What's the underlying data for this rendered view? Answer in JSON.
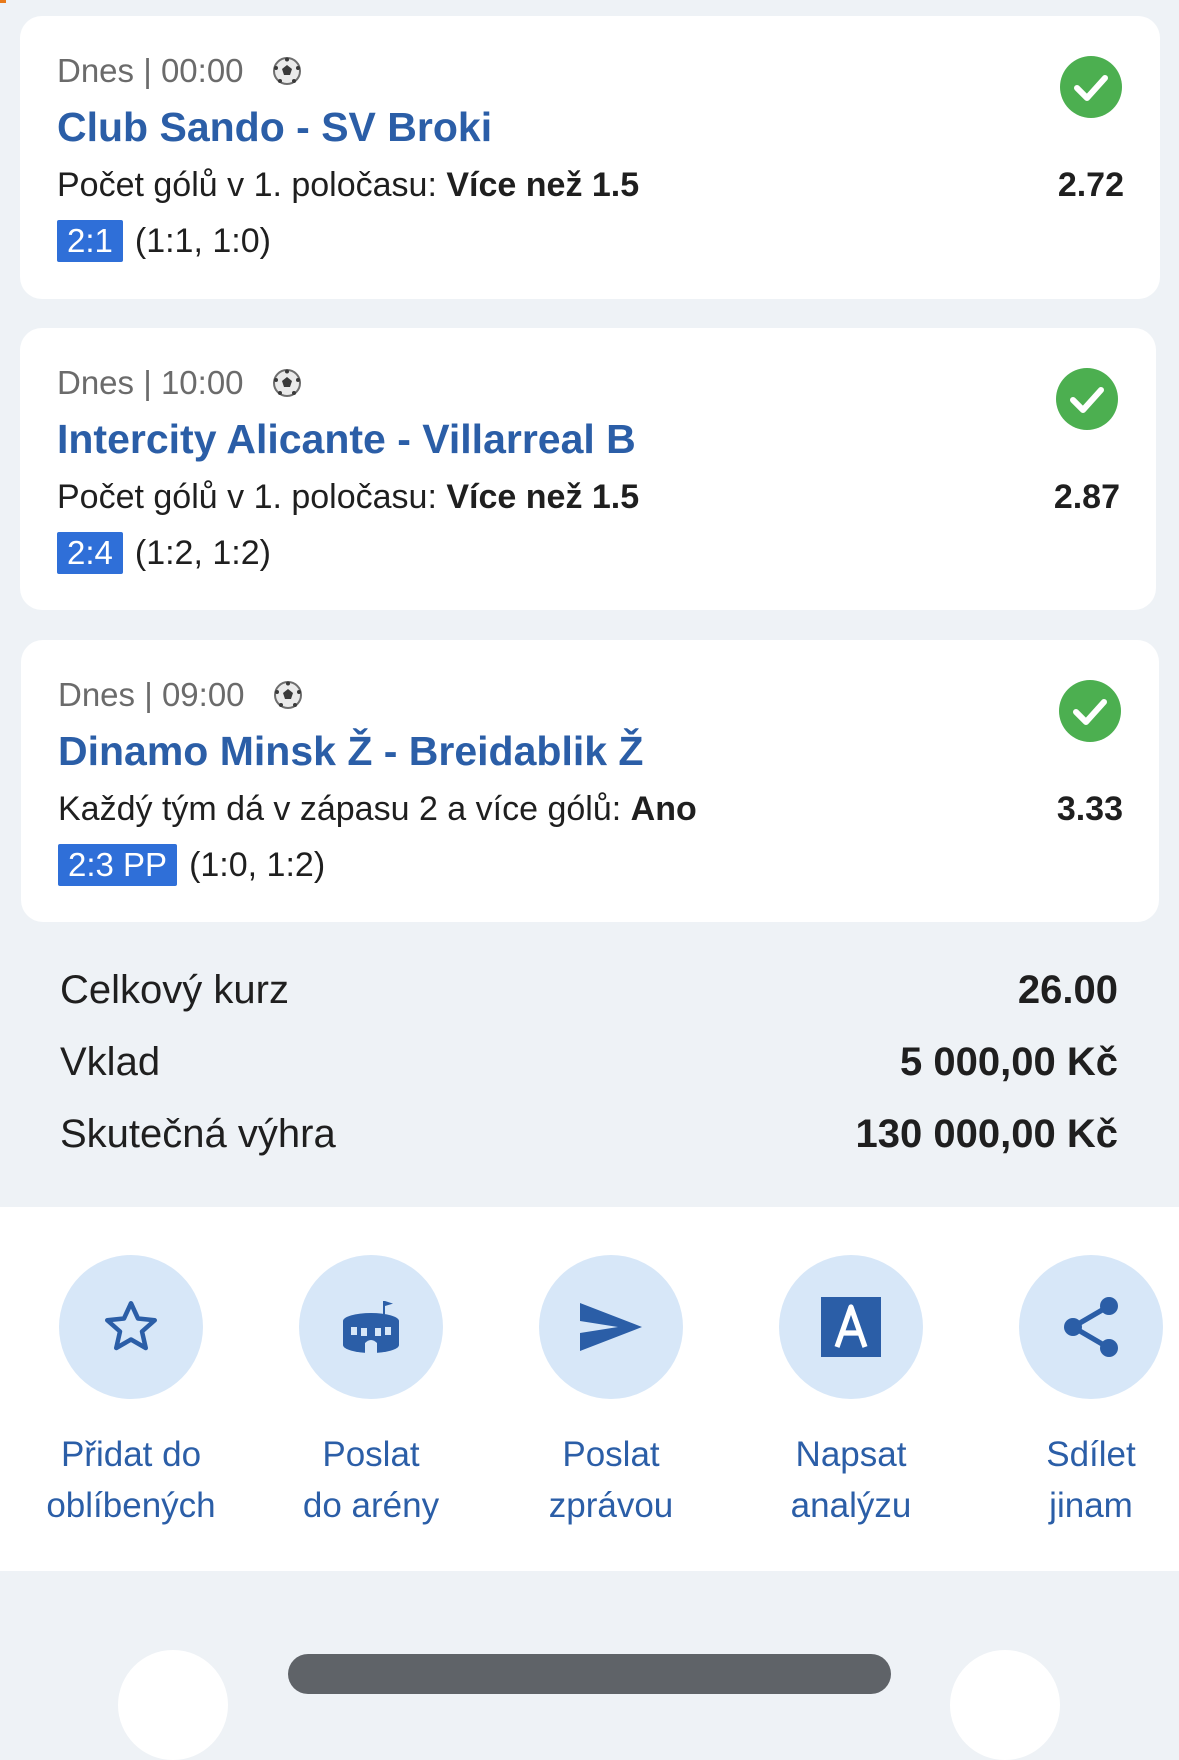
{
  "bets": [
    {
      "meta": "Dnes | 00:00",
      "match": "Club Sando - SV Broki",
      "market": "Počet gólů v 1. poločasu:",
      "selection": "Více než 1.5",
      "odds": "2.72",
      "score": "2:1",
      "half_scores": "(1:1, 1:0)",
      "status": "won"
    },
    {
      "meta": "Dnes | 10:00",
      "match": "Intercity Alicante - Villarreal B",
      "market": "Počet gólů v 1. poločasu:",
      "selection": "Více než 1.5",
      "odds": "2.87",
      "score": "2:4",
      "half_scores": "(1:2, 1:2)",
      "status": "won"
    },
    {
      "meta": "Dnes | 09:00",
      "match": "Dinamo Minsk Ž - Breidablik Ž",
      "market": "Každý tým dá v zápasu 2 a více gólů:",
      "selection": "Ano",
      "odds": "3.33",
      "score": "2:3 PP",
      "half_scores": "(1:0, 1:2)",
      "status": "won"
    }
  ],
  "summary": {
    "total_odds_label": "Celkový kurz",
    "total_odds_value": "26.00",
    "stake_label": "Vklad",
    "stake_value": "5 000,00 Kč",
    "payout_label": "Skutečná výhra",
    "payout_value": "130 000,00 Kč"
  },
  "actions": [
    {
      "label": "Přidat do\noblíbených",
      "icon": "star-icon"
    },
    {
      "label": "Poslat\ndo arény",
      "icon": "arena-icon"
    },
    {
      "label": "Poslat\nzprávou",
      "icon": "send-icon"
    },
    {
      "label": "Napsat\nanalýzu",
      "icon": "analysis-icon"
    },
    {
      "label": "Sdílet\njinam",
      "icon": "share-icon"
    }
  ],
  "colors": {
    "accent_blue": "#2b5ea7",
    "score_badge": "#2f6fd8",
    "success_green": "#4caf50",
    "action_circle": "#d7e7f8",
    "page_bg": "#eef2f6"
  }
}
